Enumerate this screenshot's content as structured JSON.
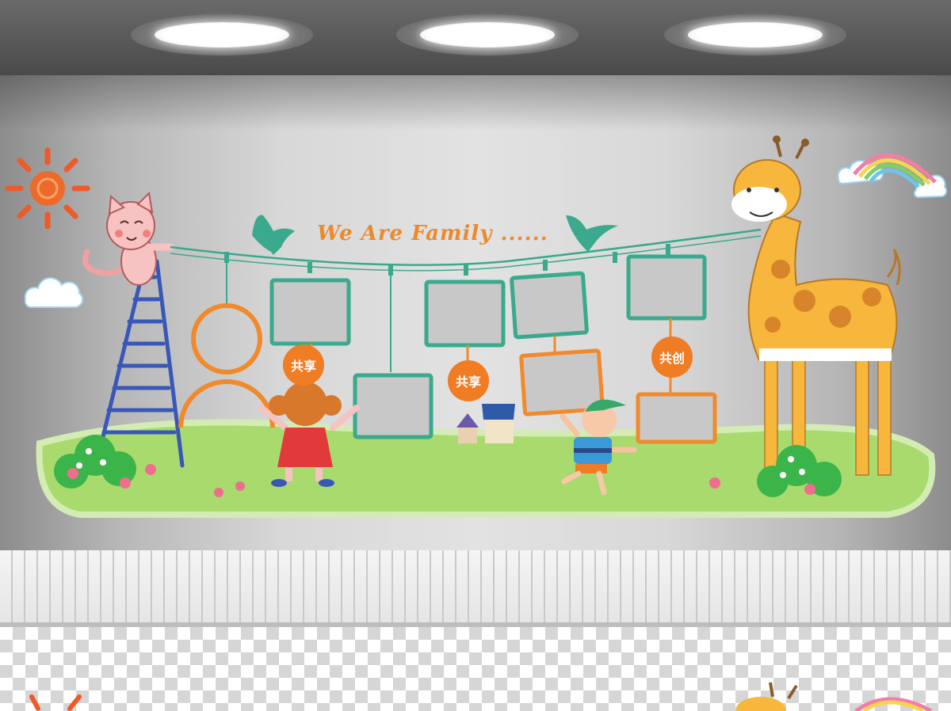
{
  "title": "We Are Family ......",
  "badges": [
    "共享",
    "共享",
    "共创"
  ],
  "colors": {
    "frame_teal": "#3aa98d",
    "frame_orange": "#f08a2c",
    "badge_orange": "#f07c23",
    "grass": "#a9da6e",
    "giraffe": "#f6b73c"
  },
  "icons": [
    "sun-icon",
    "cat-icon",
    "ladder-icon",
    "bird-icon",
    "giraffe-icon",
    "rainbow-icon",
    "cloud-icon",
    "girl-icon",
    "boy-icon",
    "house-icon",
    "flower-icon",
    "spotlight-icon"
  ]
}
